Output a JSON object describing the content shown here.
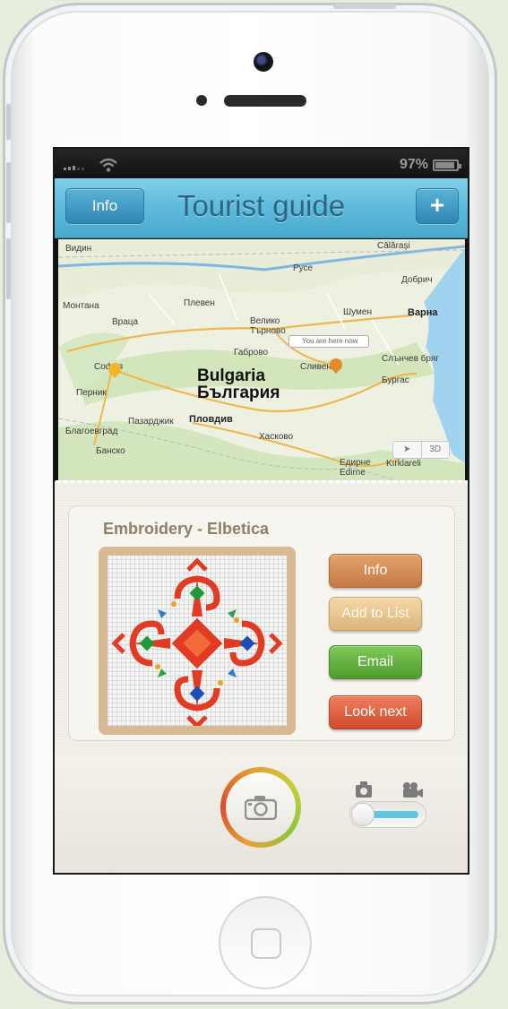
{
  "status_bar": {
    "battery_percent": "97%"
  },
  "nav_bar": {
    "title": "Tourist guide",
    "left_button": "Info",
    "right_button": "+"
  },
  "map": {
    "country_label_en": "Bulgaria",
    "country_label_bg": "България",
    "you_are_here": "You are here now",
    "controls": [
      "➤",
      "3D"
    ],
    "cities": [
      "Видин",
      "Călărași",
      "Русе",
      "Добрич",
      "Монтана",
      "Плевен",
      "Враца",
      "Велико Търново",
      "Шумен",
      "Варна",
      "Габрово",
      "София",
      "Сливен",
      "Слънчев бряг",
      "Перник",
      "Бургас",
      "Пазарджик",
      "Пловдив",
      "Благоевград",
      "Хасково",
      "Банско",
      "Едирне",
      "Edirne",
      "Kırklareli"
    ]
  },
  "item": {
    "title": "Embroidery - Elbetica"
  },
  "actions": {
    "info": "Info",
    "add_to_list": "Add to List",
    "email": "Email",
    "look_next": "Look next"
  },
  "capture": {
    "mode": "photo"
  }
}
